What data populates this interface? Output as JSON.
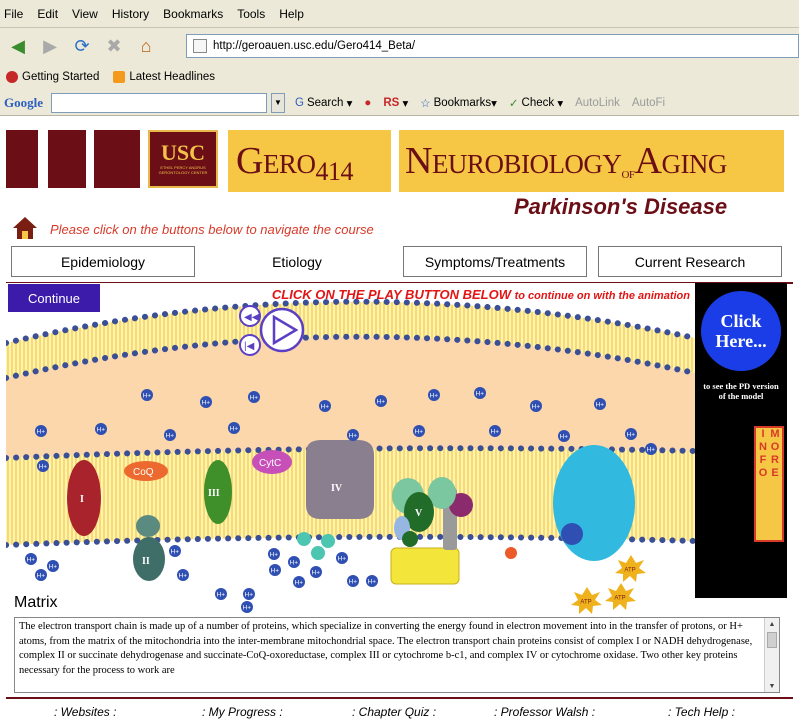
{
  "browser": {
    "menu": [
      "File",
      "Edit",
      "View",
      "History",
      "Bookmarks",
      "Tools",
      "Help"
    ],
    "url": "http://geroauen.usc.edu/Gero414_Beta/",
    "bookmarks": [
      "Getting Started",
      "Latest Headlines"
    ],
    "toolbar": {
      "google_logo": "Google",
      "search_label": "Search",
      "rs_label": "RS",
      "bookmarks_label": "Bookmarks",
      "check_label": "Check",
      "autolink_label": "AutoLink",
      "autofill_label": "AutoFi"
    }
  },
  "header": {
    "logo_text": "USC",
    "logo_sub": "ETHEL PERCY ANDRUS GERONTOLOGY CENTER",
    "course_code_main": "Gero",
    "course_code_num": "414",
    "title_part1": "Neurobiology",
    "title_of": "of",
    "title_part2": "Aging",
    "subtitle": "Parkinson's Disease",
    "nav_hint": "Please click on the buttons below to navigate the course",
    "tabs": [
      "Epidemiology",
      "Etiology",
      "Symptoms/Treatments",
      "Current Research"
    ]
  },
  "stage": {
    "continue_label": "Continue",
    "prompt_main": "CLICK ON THE PLAY BUTTON BELOW",
    "prompt_rest": "to continue on with the animation",
    "coq_label": "CoQ",
    "cytc_label": "CytC",
    "complex_labels": [
      "I",
      "II",
      "III",
      "IV",
      "V"
    ],
    "hplus": "H+",
    "atp": "ATP",
    "matrix_label": "Matrix"
  },
  "side_panel": {
    "click_here": "Click Here...",
    "pd_note": "to see the PD version of the model",
    "more_info": "MORE INFO"
  },
  "description": "The electron transport chain is made up of a number of proteins, which specialize in converting the energy found in electron movement into in the transfer of protons, or H+ atoms, from the matrix of the mitochondria into the inter-membrane mitochondrial space. The electron transport chain proteins consist of complex I or NADH dehydrogenase, complex II or succinate dehydrogenase and succinate-CoQ-oxoreductase, complex III or cytochrome b-c1, and complex IV or cytochrome oxidase. Two other key proteins necessary for the process to work are",
  "footer": {
    "links": [
      ": Websites :",
      ": My Progress :",
      ": Chapter Quiz :",
      ": Professor Walsh :",
      ": Tech Help :"
    ]
  },
  "colors": {
    "maroon": "#6b0e16",
    "gold": "#f6c744",
    "accent_red": "#d83a2a",
    "continue_blue": "#3c1bab"
  }
}
